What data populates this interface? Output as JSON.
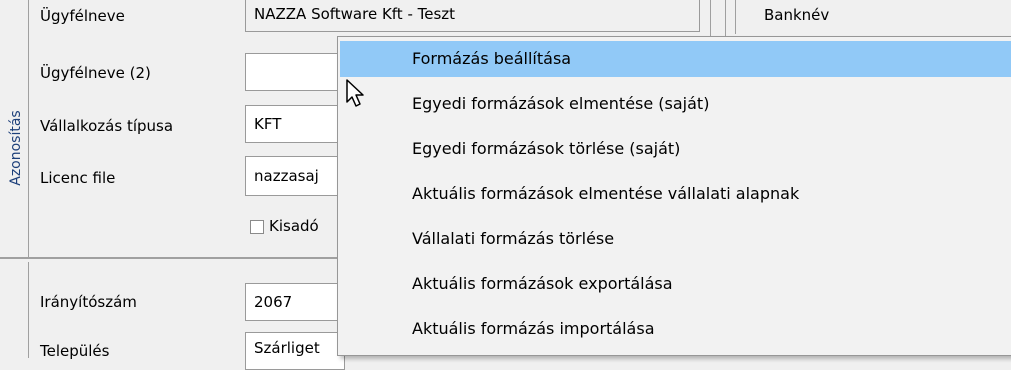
{
  "group1": {
    "tab_label": "Azonosítás",
    "fields": [
      {
        "label": "Ügyfélneve",
        "value": "NAZZA Software Kft - Teszt"
      },
      {
        "label": "Ügyfélneve (2)",
        "value": ""
      },
      {
        "label": "Vállalkozás típusa",
        "value": "KFT"
      },
      {
        "label": "Licenc file",
        "value": "nazzasaj"
      }
    ],
    "checkbox_label": "Kisadó"
  },
  "right_panel": {
    "header": "Banknév"
  },
  "group2": {
    "fields": [
      {
        "label": "Irányítószám",
        "value": "2067"
      },
      {
        "label": "Település",
        "value": "Szárliget"
      }
    ]
  },
  "context_menu": {
    "items": [
      "Formázás beállítása",
      "Egyedi formázások elmentése (saját)",
      "Egyedi formázások törlése (saját)",
      "Aktuális formázások elmentése vállalati alapnak",
      "Vállalati formázás törlése",
      "Aktuális formázások exportálása",
      "Aktuális formázás importálása"
    ],
    "highlighted_index": 0
  }
}
